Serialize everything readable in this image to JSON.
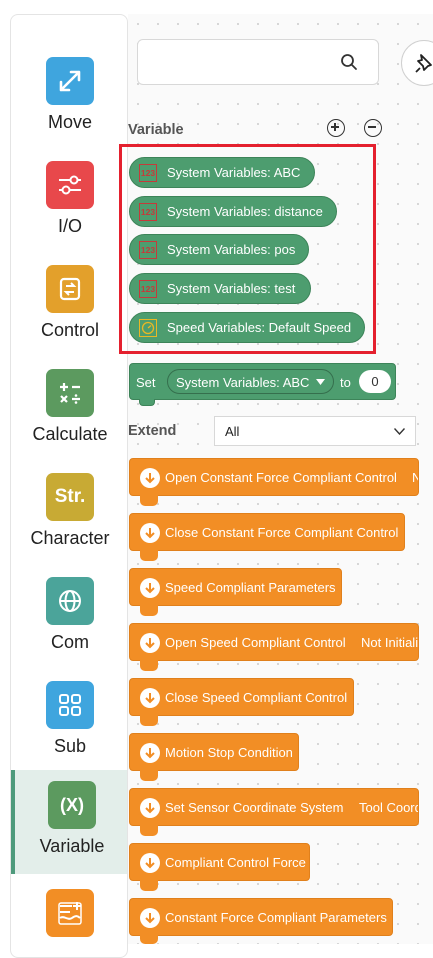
{
  "sidebar": {
    "items": [
      {
        "label": "Move",
        "icon": "move-arrows-icon",
        "color": "#3fa5de"
      },
      {
        "label": "I/O",
        "icon": "io-switch-icon",
        "color": "#e8484b"
      },
      {
        "label": "Control",
        "icon": "control-loop-icon",
        "color": "#e3a02b"
      },
      {
        "label": "Calculate",
        "icon": "calculator-icon",
        "color": "#5c9a5f"
      },
      {
        "label": "Character",
        "icon": "string-icon",
        "color": "#c8aa34",
        "glyph": "Str."
      },
      {
        "label": "Com",
        "icon": "globe-icon",
        "color": "#4ba49a"
      },
      {
        "label": "Sub",
        "icon": "grid-icon",
        "color": "#3fa5de"
      },
      {
        "label": "Variable",
        "icon": "variable-icon",
        "color": "#5c9a5f",
        "glyph": "(X)",
        "active": true
      },
      {
        "label": "",
        "icon": "table-add-icon",
        "color": "#f28e25"
      }
    ]
  },
  "search": {
    "placeholder": "",
    "icon": "search-icon"
  },
  "variable_section": {
    "title": "Variable",
    "variables": [
      {
        "name": "System Variables:  ABC",
        "icon": "number-icon",
        "glyph": "123"
      },
      {
        "name": "System Variables:  distance",
        "icon": "number-icon",
        "glyph": "123"
      },
      {
        "name": "System Variables:  pos",
        "icon": "number-icon",
        "glyph": "123"
      },
      {
        "name": "System Variables:  test",
        "icon": "number-icon",
        "glyph": "123"
      },
      {
        "name": "Speed Variables:  Default Speed",
        "icon": "speed-gauge-icon",
        "glyph": ""
      }
    ],
    "set_block": {
      "label": "Set",
      "variable": "System Variables: ABC",
      "to": "to",
      "value": "0"
    }
  },
  "extend_section": {
    "title": "Extend",
    "filter_value": "All",
    "blocks": [
      {
        "label": "Open Constant Force Compliant Control",
        "extra": "N"
      },
      {
        "label": "Close Constant Force Compliant Control",
        "extra": ""
      },
      {
        "label": "Speed Compliant Parameters",
        "extra": ""
      },
      {
        "label": "Open Speed Compliant Control",
        "extra": "Not Initiali"
      },
      {
        "label": "Close Speed Compliant Control",
        "extra": ""
      },
      {
        "label": "Motion Stop Condition",
        "extra": ""
      },
      {
        "label": "Set Sensor Coordinate System",
        "extra": "Tool Coord"
      },
      {
        "label": "Compliant Control Force",
        "extra": ""
      },
      {
        "label": "Constant Force Compliant Parameters",
        "extra": ""
      }
    ]
  },
  "colors": {
    "accent_green": "#4d9d6f",
    "block_orange": "#f28e25",
    "highlight_red": "#e4202e"
  }
}
